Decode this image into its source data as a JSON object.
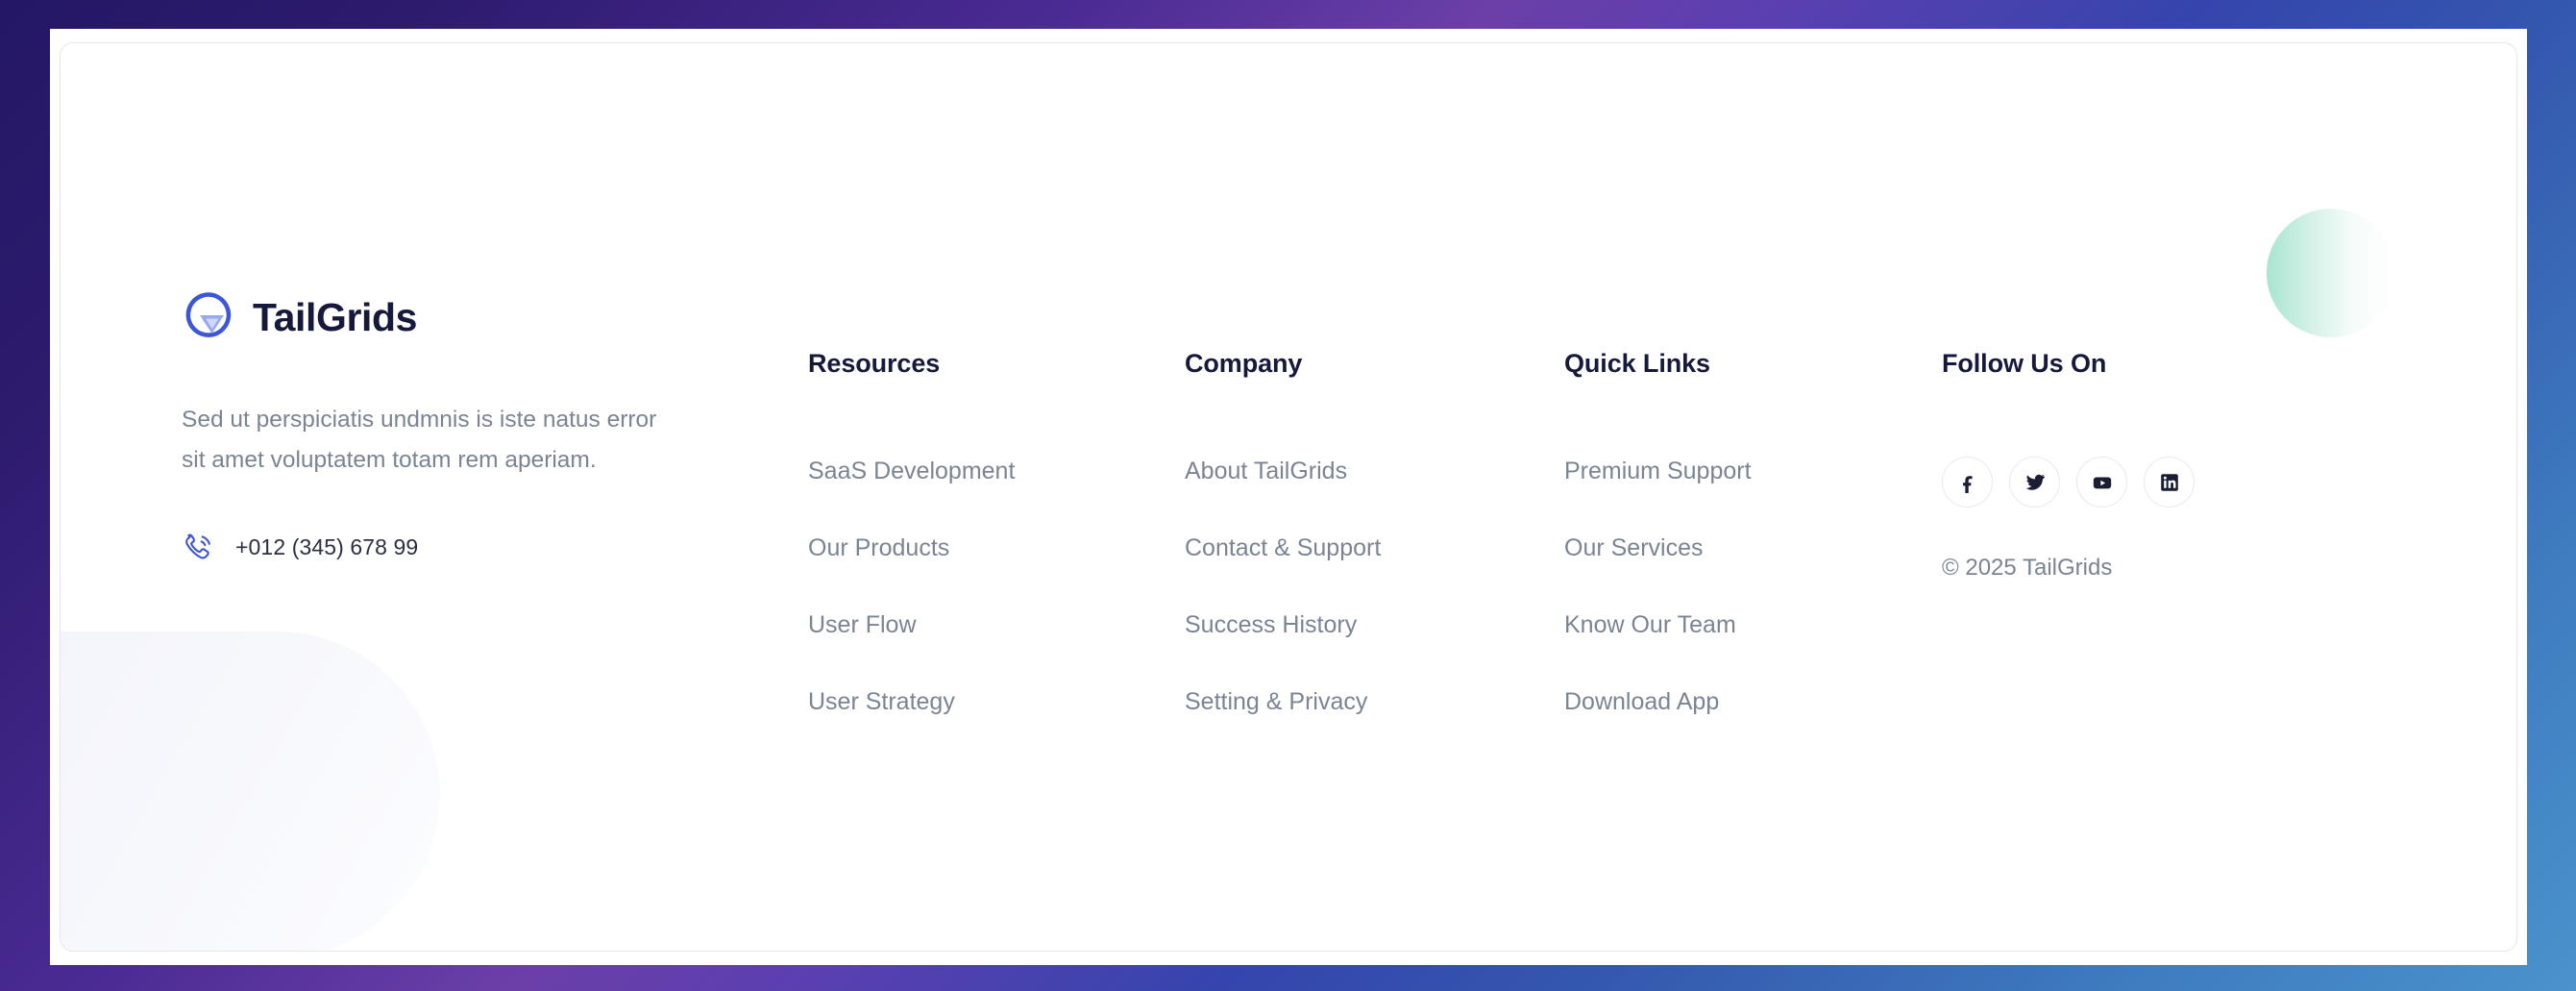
{
  "theme": {
    "background_gradient_from": "#241765",
    "background_gradient_mid": "#6b3fa8",
    "background_gradient_to": "#4a93cc",
    "card_background": "#ffffff",
    "card_border": "#e6e7ee",
    "heading_color": "#16193b",
    "link_color": "#7b8494",
    "brand_blue": "#3c56d9",
    "brand_blue_light": "#8da2f0",
    "accent_orange": "#e8522e",
    "deco_green": "#a0e2cd",
    "deco_lavender": "#f3f4fb"
  },
  "brand": {
    "logo_icon": "tailgrids-logo-icon",
    "name": "TailGrids",
    "description": "Sed ut perspiciatis undmnis is iste natus error sit amet voluptatem totam rem aperiam.",
    "phone_icon": "phone-call-icon",
    "phone": "+012 (345) 678 99"
  },
  "columns": [
    {
      "title": "Resources",
      "links": [
        "SaaS Development",
        "Our Products",
        "User Flow",
        "User Strategy"
      ]
    },
    {
      "title": "Company",
      "links": [
        "About TailGrids",
        "Contact & Support",
        "Success History",
        "Setting & Privacy"
      ]
    },
    {
      "title": "Quick Links",
      "links": [
        "Premium Support",
        "Our Services",
        "Know Our Team",
        "Download App"
      ]
    }
  ],
  "social": {
    "title": "Follow Us On",
    "items": [
      {
        "icon": "facebook-icon",
        "label": "Facebook"
      },
      {
        "icon": "twitter-icon",
        "label": "Twitter"
      },
      {
        "icon": "youtube-icon",
        "label": "YouTube"
      },
      {
        "icon": "linkedin-icon",
        "label": "LinkedIn"
      }
    ],
    "copyright": "© 2025 TailGrids"
  }
}
